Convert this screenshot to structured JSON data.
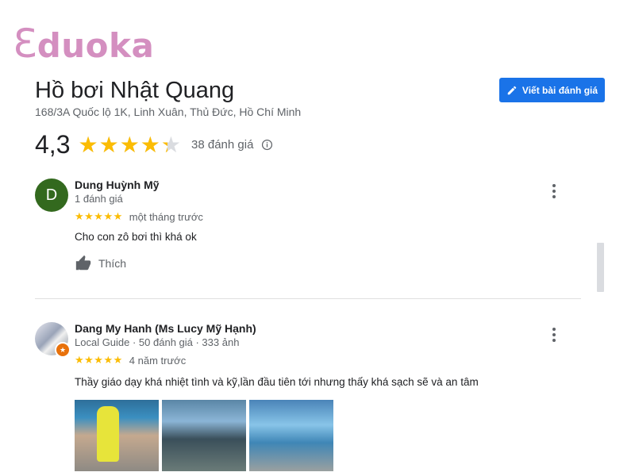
{
  "brand": {
    "logo_initial": "Ɛ",
    "logo_text": "duoka",
    "color": "#d48fc0"
  },
  "place": {
    "title": "Hồ bơi Nhật Quang",
    "address": "168/3A Quốc lộ 1K, Linh Xuân, Thủ Đức, Hồ Chí Minh",
    "rating": "4,3",
    "rating_value": 4.3,
    "review_count": "38 đánh giá",
    "write_review_label": "Viết bài đánh giá"
  },
  "colors": {
    "accent": "#1a73e8",
    "star": "#fbbc04",
    "avatar_d": "#33691e",
    "guide_badge": "#e8710a"
  },
  "reviews": [
    {
      "avatar_letter": "D",
      "name": "Dung Huỳnh Mỹ",
      "meta": "1 đánh giá",
      "stars": "★★★★★",
      "rating": 5,
      "time": "một tháng trước",
      "text": "Cho con zô bơi thì khá ok",
      "like_label": "Thích"
    },
    {
      "name": "Dang My Hanh (Ms Lucy Mỹ Hạnh)",
      "meta": "Local Guide · 50 đánh giá · 333 ảnh",
      "stars": "★★★★★",
      "rating": 5,
      "time": "4 năm trước",
      "text": "Thầy giáo dạy khá nhiệt tình và kỹ,lần đầu tiên tới nhưng thấy khá sạch sẽ và an tâm",
      "photos_count": 3
    }
  ],
  "icons": {
    "edit": "pencil-icon",
    "info": "info-icon",
    "like": "thumbs-up-icon",
    "more": "more-vert-icon",
    "guide": "local-guide-star-icon"
  }
}
